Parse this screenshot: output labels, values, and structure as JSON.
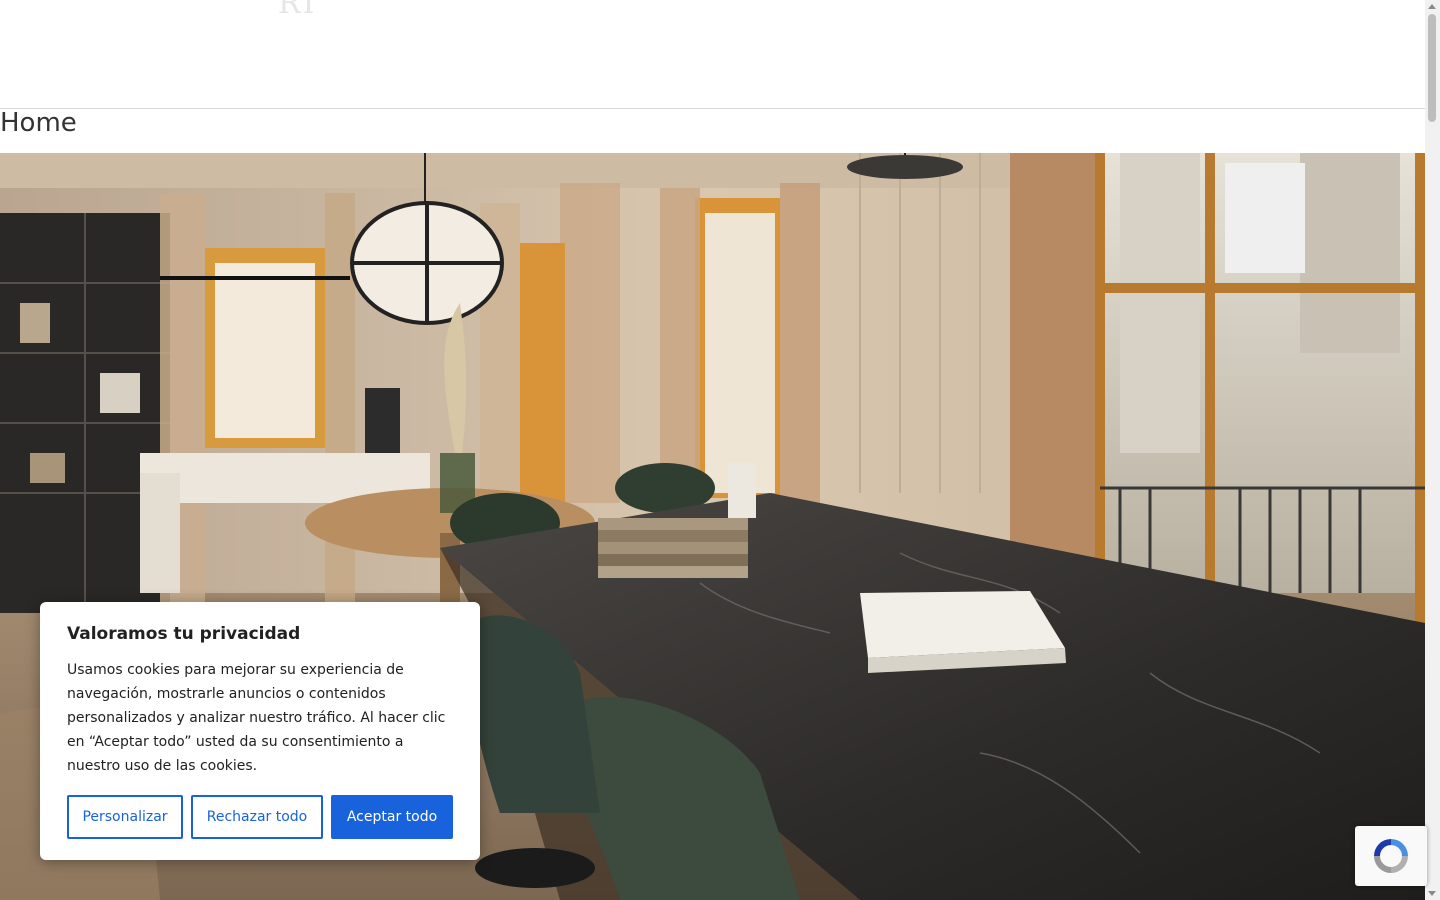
{
  "header": {
    "logo_fragment": "RI"
  },
  "page": {
    "title": "Home"
  },
  "hero": {
    "image_icon": "office-interior-photo"
  },
  "cookie_banner": {
    "title": "Valoramos tu privacidad",
    "text": "Usamos cookies para mejorar su experiencia de navegación, mostrarle anuncios o contenidos personalizados y analizar nuestro tráfico. Al hacer clic en “Aceptar todo” usted da su consentimiento a nuestro uso de las cookies.",
    "buttons": {
      "customize": "Personalizar",
      "reject": "Rechazar todo",
      "accept": "Aceptar todo"
    },
    "accent_color": "#1863dc"
  },
  "recaptcha": {
    "icon": "recaptcha-icon"
  }
}
